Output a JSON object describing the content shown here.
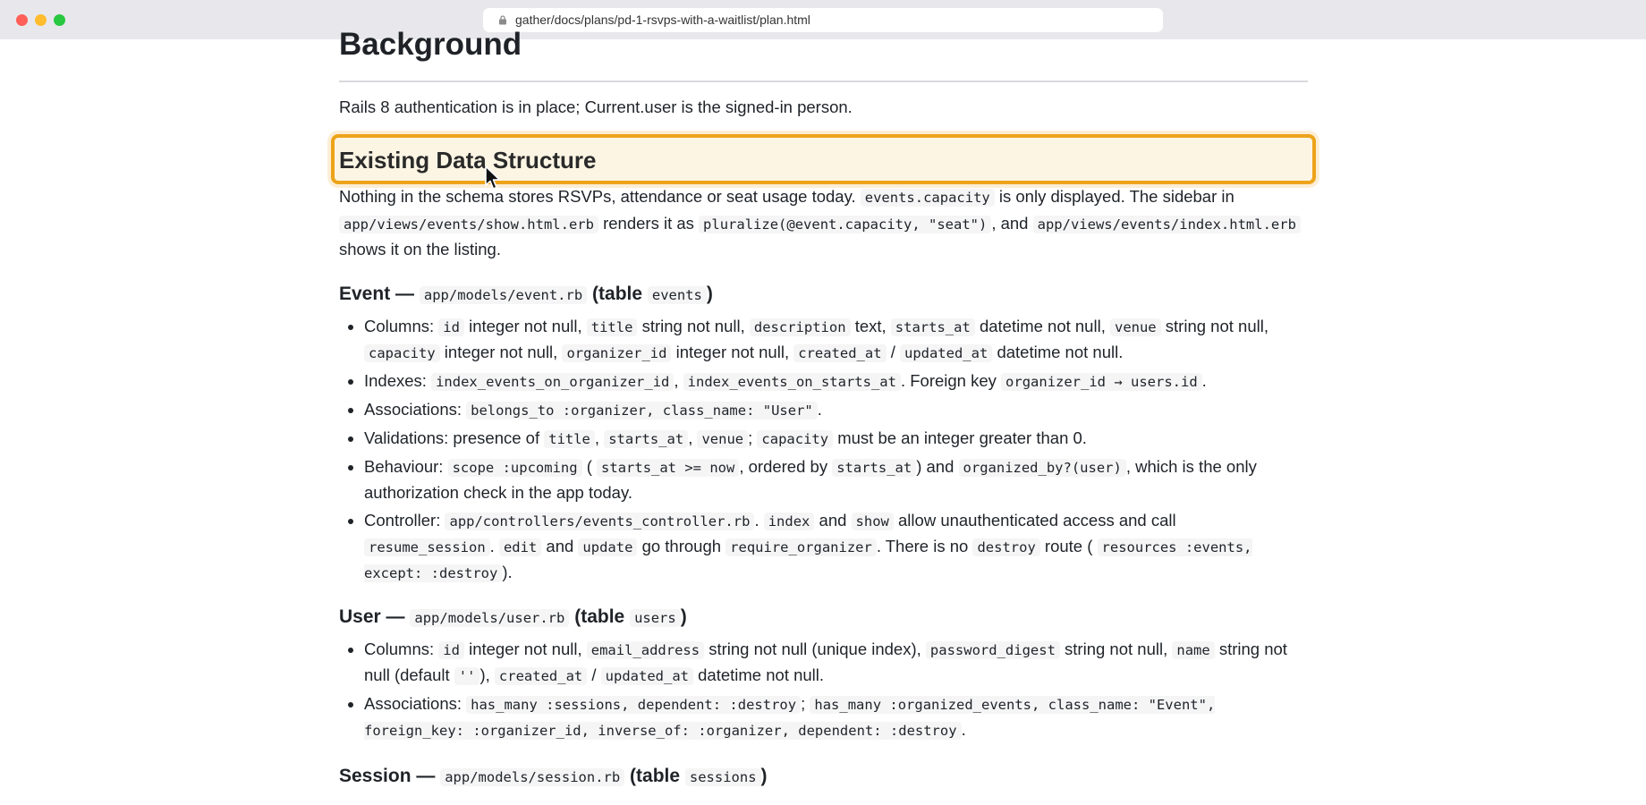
{
  "browser": {
    "url": "gather/docs/plans/pd-1-rsvps-with-a-waitlist/plan.html"
  },
  "doc": {
    "h1": "Background",
    "bg_text": "Rails 8 authentication is in place; Current.user is the signed-in person.",
    "h2": "Existing Data Structure",
    "intro": {
      "t1": "Nothing in the schema stores RSVPs, attendance or seat usage today.",
      "c1": "events.capacity",
      "t2": "is only displayed. The sidebar in",
      "c2": "app/views/events/show.html.erb",
      "t3": "renders it as",
      "c3": "pluralize(@event.capacity, \"seat\")",
      "t4": ", and",
      "c4": "app/views/events/index.html.erb",
      "t5": "shows it on the listing."
    },
    "event": {
      "h_label": "Event —",
      "h_path": "app/models/event.rb",
      "h_table_open": "(table",
      "h_table": "events",
      "h_close": ")",
      "columns": {
        "label": "Columns:",
        "c_id": "id",
        "t_id": "integer not null,",
        "c_title": "title",
        "t_title": "string not null,",
        "c_desc": "description",
        "t_desc": "text,",
        "c_starts": "starts_at",
        "t_starts": "datetime not null,",
        "c_venue": "venue",
        "t_venue": "string not null,",
        "c_capacity": "capacity",
        "t_capacity": "integer not null,",
        "c_org": "organizer_id",
        "t_org": "integer not null,",
        "c_created": "created_at",
        "slash": "/",
        "c_updated": "updated_at",
        "t_updated": "datetime not null."
      },
      "indexes": {
        "label": "Indexes:",
        "c1": "index_events_on_organizer_id",
        "comma": ",",
        "c2": "index_events_on_starts_at",
        "t1": ". Foreign key",
        "c3": "organizer_id → users.id",
        "end": "."
      },
      "assoc": {
        "label": "Associations:",
        "c1": "belongs_to :organizer, class_name: \"User\"",
        "end": "."
      },
      "valid": {
        "label": "Validations: presence of",
        "c1": "title",
        "comma1": ",",
        "c2": "starts_at",
        "comma2": ",",
        "c3": "venue",
        "semi": ";",
        "c4": "capacity",
        "t1": "must be an integer greater than 0."
      },
      "behav": {
        "label": "Behaviour:",
        "c1": "scope :upcoming",
        "t1": "(",
        "c2": "starts_at >= now",
        "t2": ", ordered by",
        "c3": "starts_at",
        "t3": ") and",
        "c4": "organized_by?(user)",
        "t4": ", which is the only authorization check in the app today."
      },
      "ctrl": {
        "label": "Controller:",
        "c1": "app/controllers/events_controller.rb",
        "t1": ".",
        "c2": "index",
        "t2": "and",
        "c3": "show",
        "t3": "allow unauthenticated access and call",
        "c4": "resume_session",
        "t4": ".",
        "c5": "edit",
        "t5": "and",
        "c6": "update",
        "t6": "go through",
        "c7": "require_organizer",
        "t7": ". There is no",
        "c8": "destroy",
        "t8": "route (",
        "c9": "resources :events, except: :destroy",
        "t9": ")."
      }
    },
    "user": {
      "h_label": "User —",
      "h_path": "app/models/user.rb",
      "h_table_open": "(table",
      "h_table": "users",
      "h_close": ")",
      "columns": {
        "label": "Columns:",
        "c_id": "id",
        "t_id": "integer not null,",
        "c_email": "email_address",
        "t_email": "string not null (unique index),",
        "c_pwd": "password_digest",
        "t_pwd": "string not null,",
        "c_name": "name",
        "t_name": "string not null (default",
        "c_default": "''",
        "t_default": "),",
        "c_created": "created_at",
        "slash": "/",
        "c_updated": "updated_at",
        "t_updated": "datetime not null."
      },
      "assoc": {
        "label": "Associations:",
        "c1": "has_many :sessions, dependent: :destroy",
        "semi": ";",
        "c2": "has_many :organized_events, class_name: \"Event\", foreign_key: :organizer_id, inverse_of: :organizer, dependent: :destroy",
        "end": "."
      }
    },
    "session": {
      "h_label": "Session —",
      "h_path": "app/models/session.rb",
      "h_table_open": "(table",
      "h_table": "sessions",
      "h_close": ")"
    }
  },
  "colors": {
    "highlight_border": "#eda31a",
    "highlight_fill": "#fdf5e4"
  }
}
